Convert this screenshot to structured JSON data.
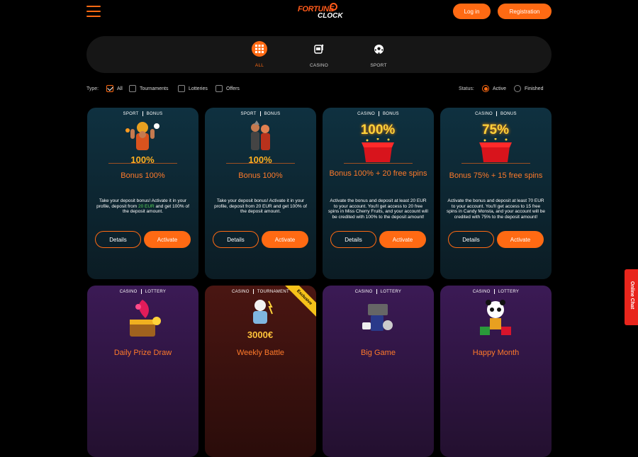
{
  "header": {
    "logo_word1": "FORTUNE",
    "logo_word2": "CLOCK",
    "login_label": "Log in",
    "register_label": "Registration"
  },
  "tabs": [
    {
      "label": "ALL",
      "icon": "grid-icon",
      "active": true
    },
    {
      "label": "CASINO",
      "icon": "slot-machine-icon",
      "active": false
    },
    {
      "label": "SPORT",
      "icon": "soccer-ball-icon",
      "active": false
    }
  ],
  "filters": {
    "type_label": "Type:",
    "type_options": [
      {
        "label": "All",
        "checked": true
      },
      {
        "label": "Tournaments",
        "checked": false
      },
      {
        "label": "Lotteries",
        "checked": false
      },
      {
        "label": "Offers",
        "checked": false
      }
    ],
    "status_label": "Status:",
    "status_options": [
      {
        "label": "Active",
        "selected": true
      },
      {
        "label": "Finished",
        "selected": false
      }
    ]
  },
  "cards": [
    {
      "cat1": "SPORT",
      "cat2": "BONUS",
      "art_text": "100%",
      "title": "Bonus 100%",
      "desc_a": "Take your deposit bonus! Activate it in your profile, deposit from ",
      "desc_hl": "20 EUR",
      "desc_b": " and get 100% of the deposit amount.",
      "details": "Details",
      "activate": "Activate"
    },
    {
      "cat1": "SPORT",
      "cat2": "BONUS",
      "art_text": "100%",
      "title": "Bonus 100%",
      "desc": "Take your deposit bonus! Activate it in your profile, deposit from 20 EUR and get 100% of the deposit amount.",
      "details": "Details",
      "activate": "Activate"
    },
    {
      "cat1": "CASINO",
      "cat2": "BONUS",
      "art_text": "100%",
      "title": "Bonus 100% + 20 free spins",
      "desc": "Activate the bonus and deposit at least 20 EUR to your account. You'll get access to 20 free spins in Miss Cherry Fruits, and your account will be credited with 100% to the deposit amount!",
      "details": "Details",
      "activate": "Activate"
    },
    {
      "cat1": "CASINO",
      "cat2": "BONUS",
      "art_text": "75%",
      "title": "Bonus 75% + 15 free spins",
      "desc": "Activate the bonus and deposit at least 70 EUR to your account. You'll get access to 15 free spins in Candy Monsta, and your account will be credited with 75% to the deposit amount!",
      "details": "Details",
      "activate": "Activate"
    },
    {
      "cat1": "CASINO",
      "cat2": "LOTTERY",
      "title": "Daily Prize Draw"
    },
    {
      "cat1": "CASINO",
      "cat2": "TOURNAMENT",
      "title": "Weekly Battle",
      "art_text": "3000€",
      "ribbon": "Exclusive"
    },
    {
      "cat1": "CASINO",
      "cat2": "LOTTERY",
      "title": "Big Game"
    },
    {
      "cat1": "CASINO",
      "cat2": "LOTTERY",
      "title": "Happy Month"
    }
  ],
  "chat_label": "Online Chat",
  "colors": {
    "accent": "#ff6a13",
    "highlight": "#5bd85b",
    "chat": "#e8251c"
  }
}
